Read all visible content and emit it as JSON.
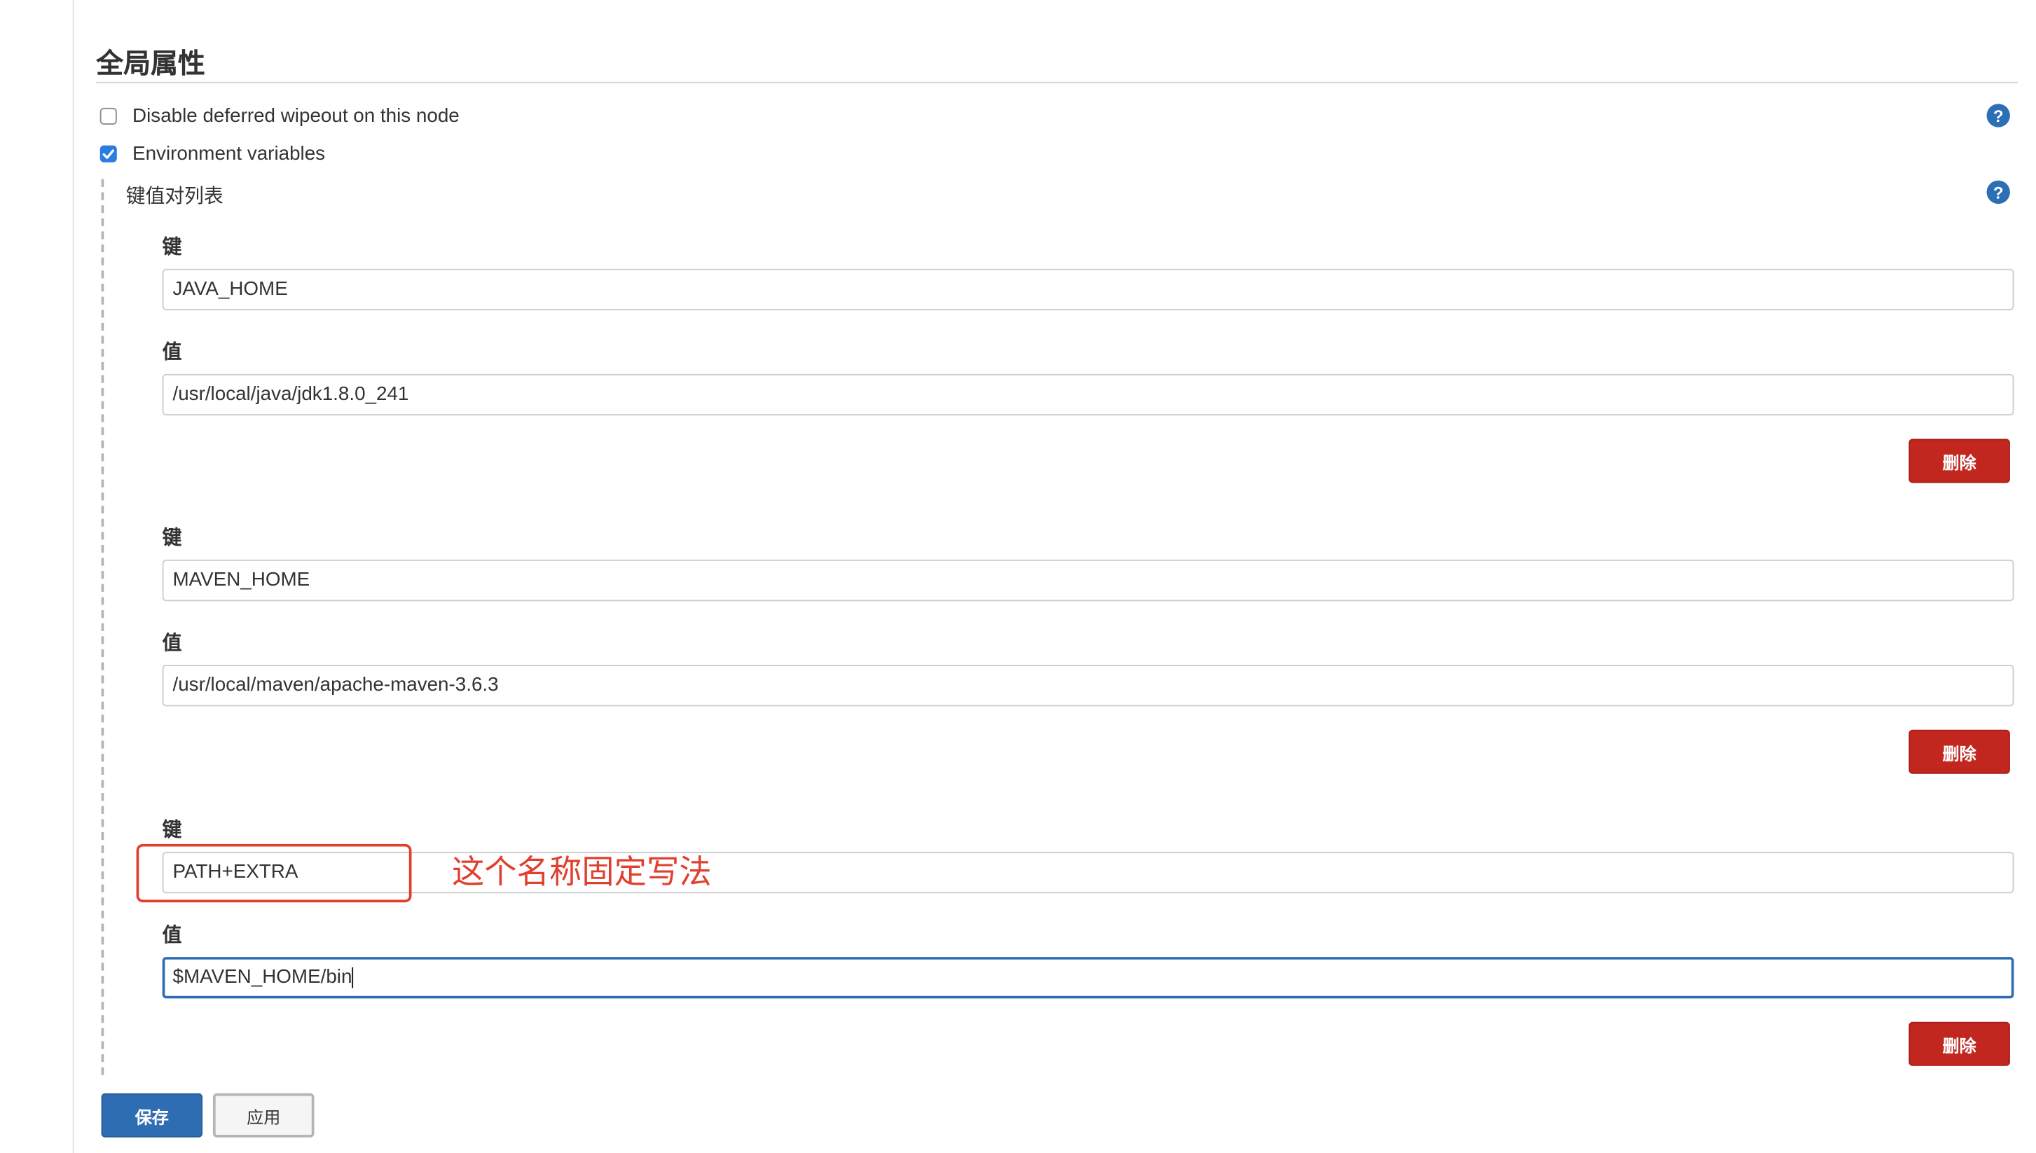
{
  "section": {
    "title": "全局属性"
  },
  "options": {
    "disable_wipeout": {
      "label": "Disable deferred wipeout on this node",
      "checked": false
    },
    "env_vars": {
      "label": "Environment variables",
      "checked": true
    }
  },
  "env": {
    "list_title": "键值对列表",
    "key_label": "键",
    "value_label": "值",
    "delete_label": "删除",
    "entries": [
      {
        "key": "JAVA_HOME",
        "value": "/usr/local/java/jdk1.8.0_241"
      },
      {
        "key": "MAVEN_HOME",
        "value": "/usr/local/maven/apache-maven-3.6.3"
      },
      {
        "key": "PATH+EXTRA",
        "value": "$MAVEN_HOME/bin"
      }
    ]
  },
  "annotation": {
    "text": "这个名称固定写法",
    "color": "#e0402f"
  },
  "footer": {
    "save_label": "保存",
    "apply_label": "应用"
  },
  "colors": {
    "help_icon": "#2c6fb5",
    "delete_button": "#c1261f",
    "save_button": "#2f6db3",
    "checkbox_checked": "#2a7de1"
  },
  "icons": {
    "help": "help-icon",
    "check": "checkmark-icon"
  }
}
